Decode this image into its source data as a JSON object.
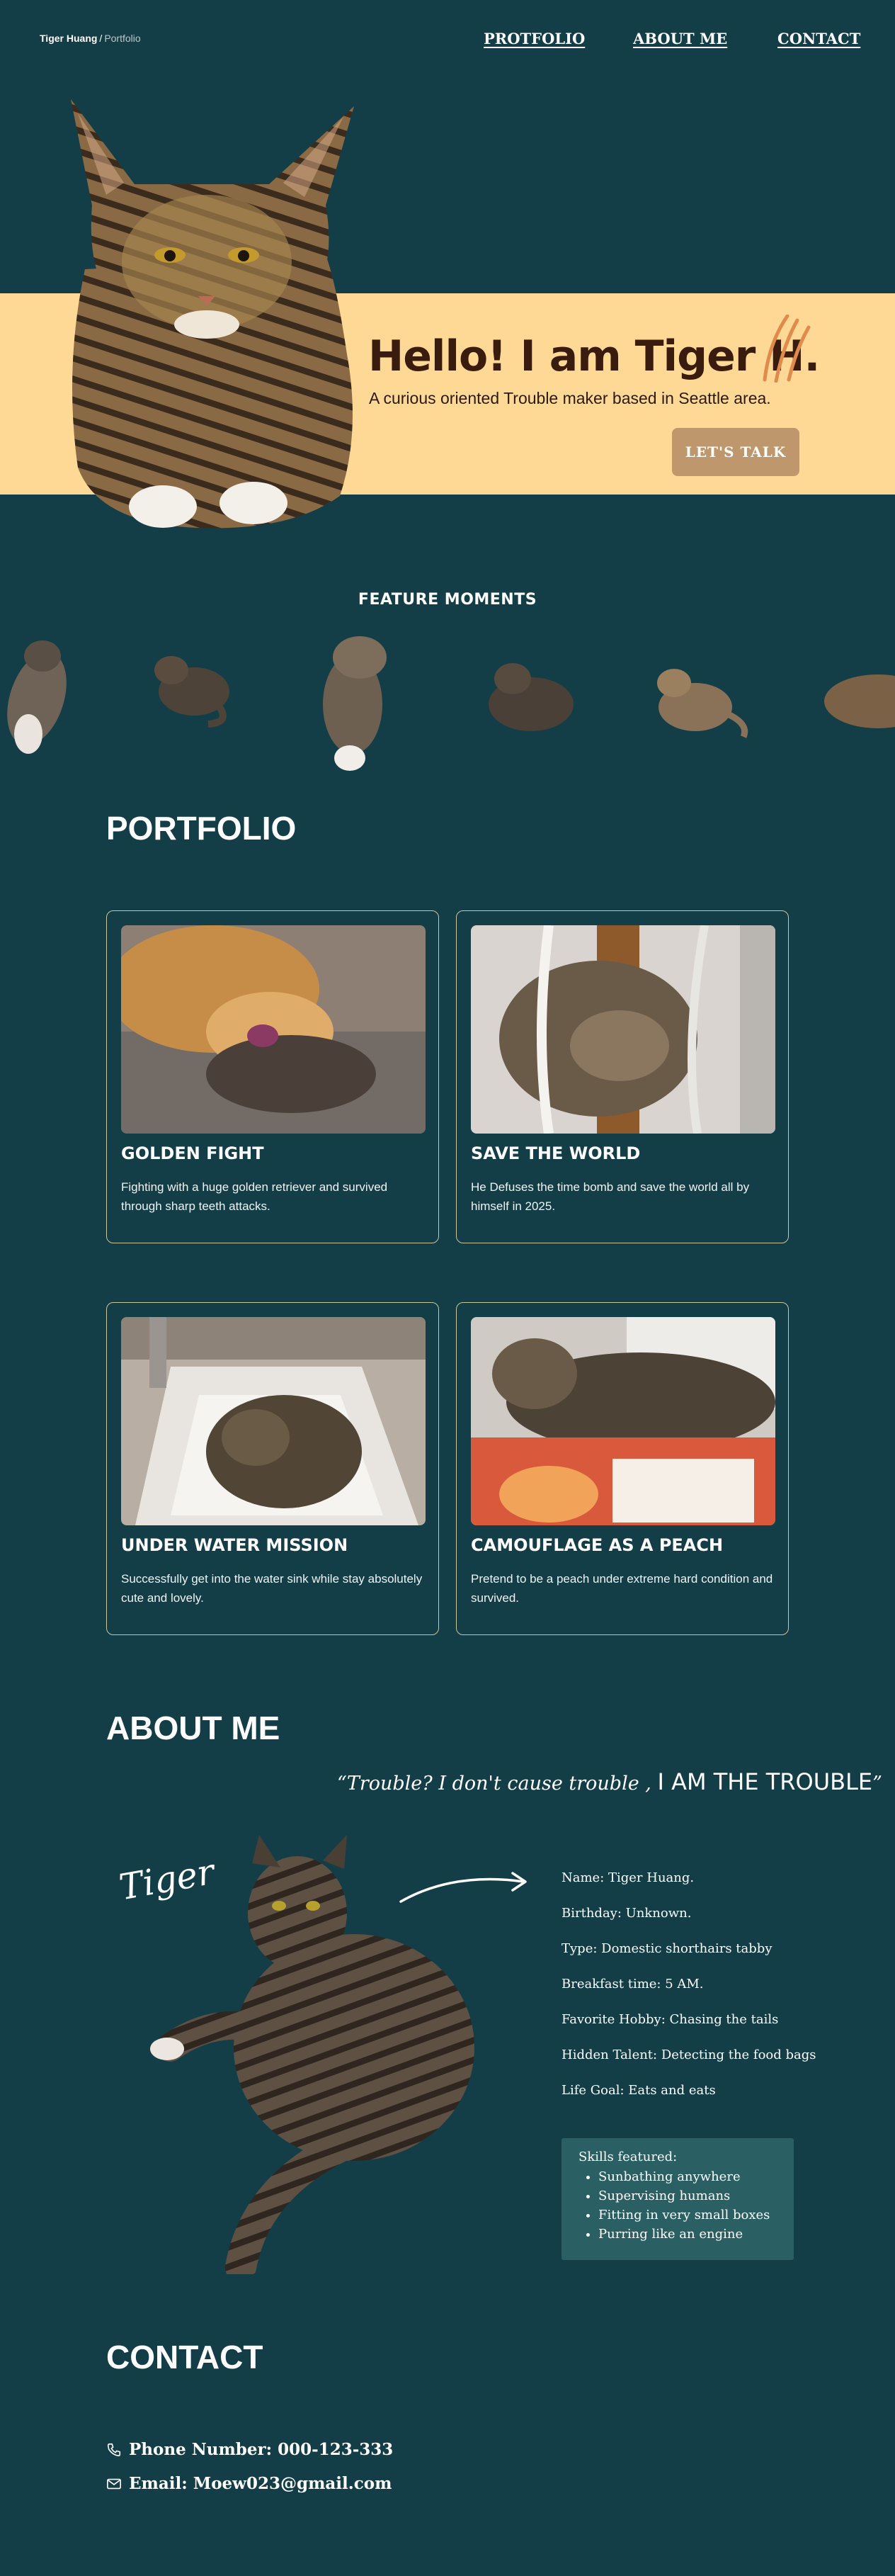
{
  "nav": {
    "brand": "Tiger Huang",
    "separator": "/",
    "current": "Portfolio",
    "links": [
      "PROTFOLIO",
      "ABOUT ME",
      "CONTACT"
    ]
  },
  "hero": {
    "title": "Hello! I am Tiger H.",
    "subtitle": "A curious oriented Trouble maker based in Seattle area.",
    "cta": "LET'S TALK"
  },
  "feature": {
    "title": "FEATURE MOMENTS"
  },
  "portfolio": {
    "title": "PORTFOLIO",
    "cards": [
      {
        "title": "GOLDEN FIGHT",
        "desc": "Fighting with a huge golden retriever and survived through sharp teeth attacks."
      },
      {
        "title": "SAVE THE WORLD",
        "desc": "He Defuses the time bomb and save the world all by himself in 2025."
      },
      {
        "title": "UNDER WATER MISSION",
        "desc": "Successfully get into the water sink while stay absolutely cute and lovely."
      },
      {
        "title": "CAMOUFLAGE AS A PEACH",
        "desc": "Pretend to be a peach under extreme hard condition and survived."
      }
    ]
  },
  "about": {
    "title": "ABOUT ME",
    "quote_a": "Trouble? I don't cause trouble ,",
    "quote_b": "I AM THE TROUBLE",
    "script_name": "Tiger",
    "facts": [
      "Name: Tiger Huang.",
      "Birthday: Unknown.",
      "Type: Domestic shorthairs tabby",
      "Breakfast time: 5 AM.",
      "Favorite Hobby: Chasing the tails",
      "Hidden Talent: Detecting the food bags",
      "Life Goal: Eats and eats"
    ],
    "skills_title": "Skills featured:",
    "skills": [
      "Sunbathing anywhere",
      "Supervising humans",
      "Fitting in very small boxes",
      "Purring like an engine"
    ]
  },
  "contact": {
    "title": "CONTACT",
    "phone": "Phone Number: 000-123-333",
    "email": "Email: Moew023@gmail.com"
  },
  "colors": {
    "background": "#143e47",
    "hero_band": "#fed895",
    "hero_title": "#3a1c0e",
    "cta": "#bf976c",
    "card_border": "#c7c79a",
    "skills_box": "#2a5f64"
  }
}
